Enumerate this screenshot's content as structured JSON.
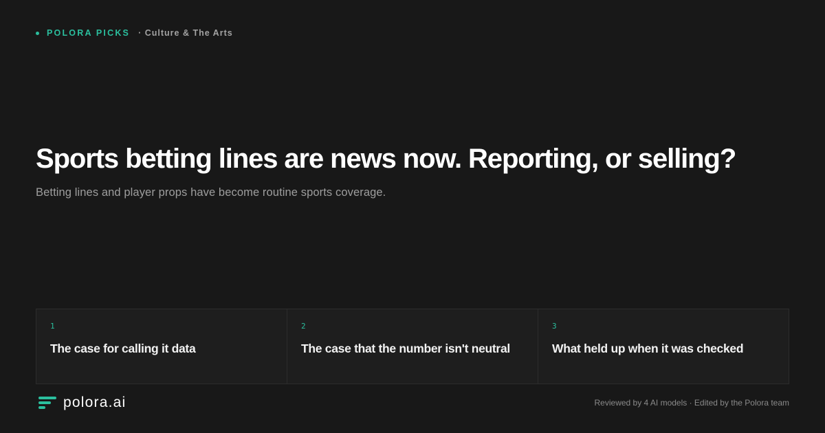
{
  "header": {
    "brand_tag": "POLORA PICKS",
    "category": "· Culture & The Arts"
  },
  "article": {
    "headline": "Sports betting lines are news now. Reporting, or selling?",
    "subhead": "Betting lines and player props have become routine sports coverage."
  },
  "sections": [
    {
      "number": "1",
      "title": "The case for calling it data"
    },
    {
      "number": "2",
      "title": "The case that the number isn't neutral"
    },
    {
      "number": "3",
      "title": "What held up when it was checked"
    }
  ],
  "footer": {
    "logo_text": "polora.ai",
    "credit": "Reviewed by 4 AI models · Edited by the Polora team"
  },
  "colors": {
    "background": "#181818",
    "accent": "#2bbf9e",
    "card_background": "#1e1e1e"
  },
  "icons": {
    "brand_dot": "dot-icon",
    "logo": "polora-logo-icon"
  }
}
